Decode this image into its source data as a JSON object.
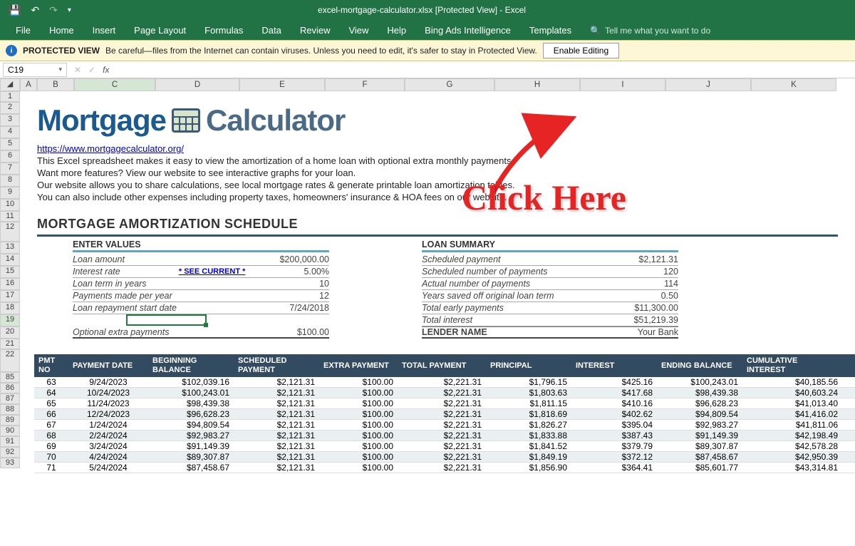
{
  "titlebar": {
    "title": "excel-mortgage-calculator.xlsx  [Protected View]  -  Excel"
  },
  "ribbon": {
    "tabs": [
      "File",
      "Home",
      "Insert",
      "Page Layout",
      "Formulas",
      "Data",
      "Review",
      "View",
      "Help",
      "Bing Ads Intelligence",
      "Templates"
    ],
    "tell_me": "Tell me what you want to do"
  },
  "protected_view": {
    "label": "PROTECTED VIEW",
    "message": "Be careful—files from the Internet can contain viruses. Unless you need to edit, it's safer to stay in Protected View.",
    "button": "Enable Editing"
  },
  "name_box": "C19",
  "fx_label": "fx",
  "col_headers": [
    "A",
    "B",
    "C",
    "D",
    "E",
    "F",
    "G",
    "H",
    "I",
    "J",
    "K"
  ],
  "row_headers_top": [
    "1",
    "2",
    "3",
    "4",
    "5",
    "6",
    "7",
    "8",
    "9",
    "10",
    "11",
    "12",
    "13",
    "14",
    "15",
    "16",
    "17",
    "18",
    "19",
    "20",
    "21",
    "22"
  ],
  "row_headers_bottom": [
    "85",
    "86",
    "87",
    "88",
    "89",
    "90",
    "91",
    "92",
    "93"
  ],
  "logo": {
    "part1": "Mortgage",
    "part2": "Calculator"
  },
  "intro": {
    "link": "https://www.mortgagecalculator.org/",
    "l1": "This Excel spreadsheet makes it easy to view the amortization of a home loan with optional extra monthly payments.",
    "l2": "Want more features? View our website to see interactive graphs for your loan.",
    "l3": "Our website allows you to share calculations, see local mortgage rates & generate printable loan amortization tables.",
    "l4": "You can also include other expenses including property taxes, homeowners' insurance & HOA fees on our website."
  },
  "schedule_title": "MORTGAGE AMORTIZATION SCHEDULE",
  "enter_values": {
    "header": "ENTER VALUES",
    "rows": [
      {
        "lbl": "Loan amount",
        "val": "$200,000.00"
      },
      {
        "lbl": "Interest rate",
        "mid": "* SEE CURRENT *",
        "val": "5.00%"
      },
      {
        "lbl": "Loan term in years",
        "val": "10"
      },
      {
        "lbl": "Payments made per year",
        "val": "12"
      },
      {
        "lbl": "Loan repayment start date",
        "val": "7/24/2018"
      }
    ],
    "optional_label": "Optional extra payments",
    "optional_value": "$100.00"
  },
  "loan_summary": {
    "header": "LOAN SUMMARY",
    "rows": [
      {
        "lbl": "Scheduled payment",
        "val": "$2,121.31"
      },
      {
        "lbl": "Scheduled number of payments",
        "val": "120"
      },
      {
        "lbl": "Actual number of payments",
        "val": "114"
      },
      {
        "lbl": "Years saved off original loan term",
        "val": "0.50"
      },
      {
        "lbl": "Total early payments",
        "val": "$11,300.00"
      },
      {
        "lbl": "Total interest",
        "val": "$51,219.39"
      }
    ],
    "lender_label": "LENDER NAME",
    "lender_value": "Your Bank"
  },
  "amort": {
    "headers": [
      "PMT NO",
      "PAYMENT DATE",
      "BEGINNING BALANCE",
      "SCHEDULED PAYMENT",
      "EXTRA PAYMENT",
      "TOTAL PAYMENT",
      "PRINCIPAL",
      "INTEREST",
      "ENDING BALANCE",
      "CUMULATIVE INTEREST"
    ],
    "rows": [
      [
        "63",
        "9/24/2023",
        "$102,039.16",
        "$2,121.31",
        "$100.00",
        "$2,221.31",
        "$1,796.15",
        "$425.16",
        "$100,243.01",
        "$40,185.56"
      ],
      [
        "64",
        "10/24/2023",
        "$100,243.01",
        "$2,121.31",
        "$100.00",
        "$2,221.31",
        "$1,803.63",
        "$417.68",
        "$98,439.38",
        "$40,603.24"
      ],
      [
        "65",
        "11/24/2023",
        "$98,439.38",
        "$2,121.31",
        "$100.00",
        "$2,221.31",
        "$1,811.15",
        "$410.16",
        "$96,628.23",
        "$41,013.40"
      ],
      [
        "66",
        "12/24/2023",
        "$96,628.23",
        "$2,121.31",
        "$100.00",
        "$2,221.31",
        "$1,818.69",
        "$402.62",
        "$94,809.54",
        "$41,416.02"
      ],
      [
        "67",
        "1/24/2024",
        "$94,809.54",
        "$2,121.31",
        "$100.00",
        "$2,221.31",
        "$1,826.27",
        "$395.04",
        "$92,983.27",
        "$41,811.06"
      ],
      [
        "68",
        "2/24/2024",
        "$92,983.27",
        "$2,121.31",
        "$100.00",
        "$2,221.31",
        "$1,833.88",
        "$387.43",
        "$91,149.39",
        "$42,198.49"
      ],
      [
        "69",
        "3/24/2024",
        "$91,149.39",
        "$2,121.31",
        "$100.00",
        "$2,221.31",
        "$1,841.52",
        "$379.79",
        "$89,307.87",
        "$42,578.28"
      ],
      [
        "70",
        "4/24/2024",
        "$89,307.87",
        "$2,121.31",
        "$100.00",
        "$2,221.31",
        "$1,849.19",
        "$372.12",
        "$87,458.67",
        "$42,950.39"
      ],
      [
        "71",
        "5/24/2024",
        "$87,458.67",
        "$2,121.31",
        "$100.00",
        "$2,221.31",
        "$1,856.90",
        "$364.41",
        "$85,601.77",
        "$43,314.81"
      ]
    ]
  },
  "annotation": {
    "text": "Click Here"
  }
}
